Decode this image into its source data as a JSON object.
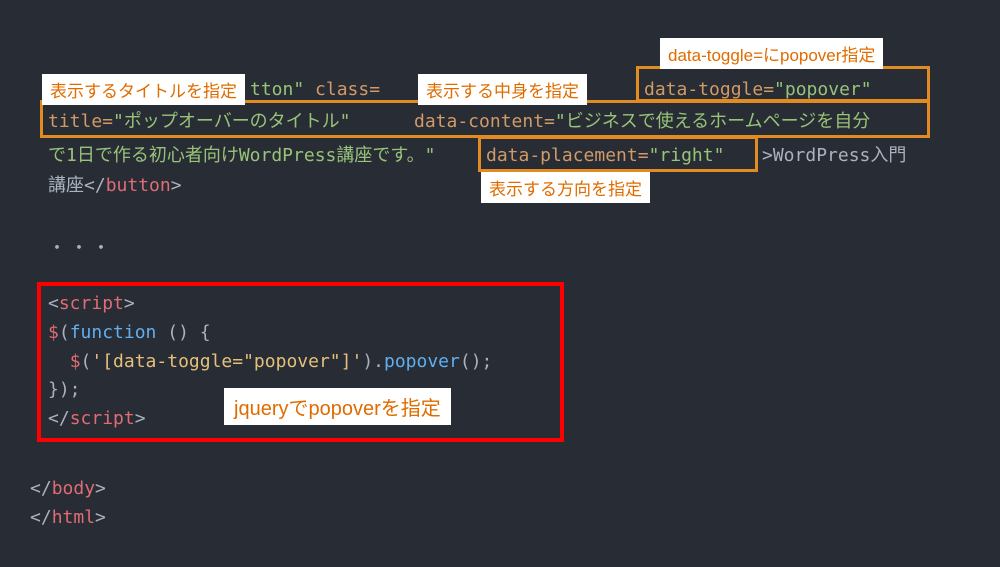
{
  "annotations": {
    "top_right": "data-toggle=にpopover指定",
    "title_anno": "表示するタイトルを指定",
    "content_anno": "表示する中身を指定",
    "placement_anno": "表示する方向を指定",
    "jquery_anno": "jqueryでpopoverを指定"
  },
  "code": {
    "line1": {
      "part1_pre": "tton\"",
      "part1_class": " class=",
      "part2_attr": "data-toggle=",
      "part2_val": "\"popover\""
    },
    "line2": {
      "attr1": "title=",
      "val1": "\"ポップオーバーのタイトル\"",
      "attr2": "data-content=",
      "val2": "\"ビジネスで使えるホームページを自分"
    },
    "line3": {
      "val_cont": "で1日で作る初心者向けWordPress講座です。\"",
      "attr3": "data-placement=",
      "val3": "\"right\"",
      "close1": ">",
      "text": "WordPress入門"
    },
    "line4": {
      "text": "講座",
      "close1": "</",
      "tag": "button",
      "close2": ">"
    },
    "dots": "・・・",
    "script_block": {
      "l1_open": "<",
      "l1_tag": "script",
      "l1_close": ">",
      "l2_dollar": "$",
      "l2_paren": "(",
      "l2_func": "function",
      "l2_rest": " () {",
      "l3_indent": "  ",
      "l3_dollar": "$",
      "l3_paren": "(",
      "l3_sel": "'[data-toggle=\"popover\"]'",
      "l3_paren2": ").",
      "l3_method": "popover",
      "l3_end": "();",
      "l4": "});",
      "l5_open": "</",
      "l5_tag": "script",
      "l5_close": ">"
    },
    "footer": {
      "l1_open": "</",
      "l1_tag": "body",
      "l1_close": ">",
      "l2_open": "</",
      "l2_tag": "html",
      "l2_close": ">"
    }
  }
}
